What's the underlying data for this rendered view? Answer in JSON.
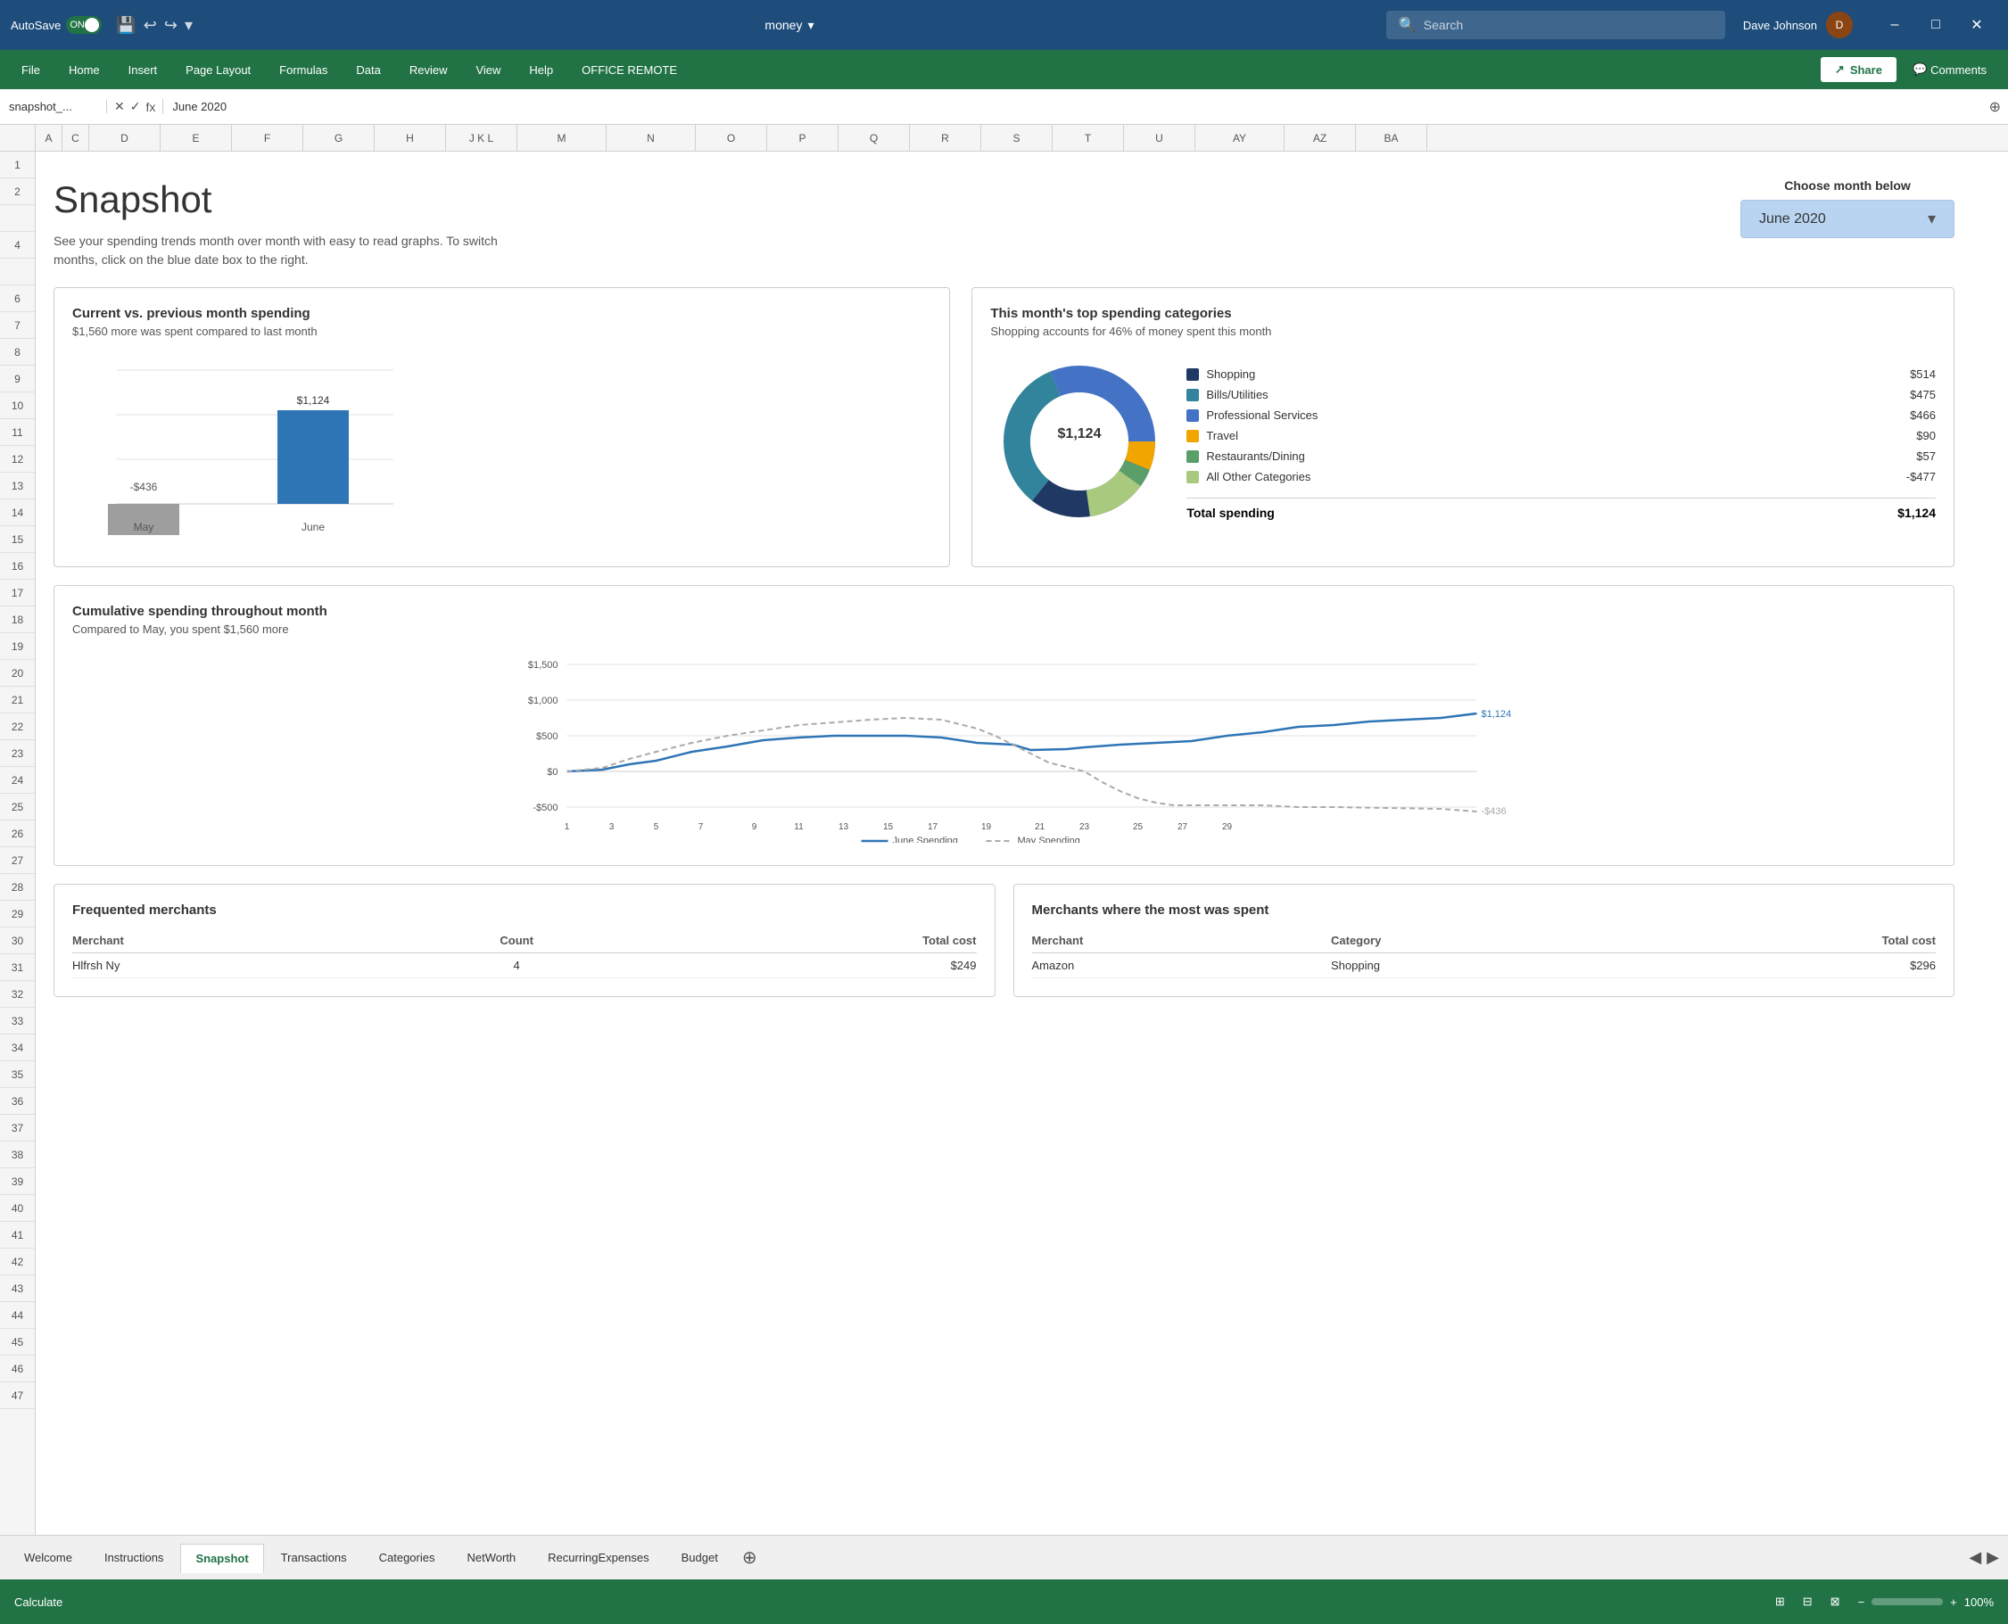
{
  "titlebar": {
    "autosave_label": "AutoSave",
    "autosave_state": "ON",
    "doc_name": "money",
    "search_placeholder": "Search",
    "user_name": "Dave Johnson"
  },
  "menubar": {
    "items": [
      "File",
      "Home",
      "Insert",
      "Page Layout",
      "Formulas",
      "Data",
      "Review",
      "View",
      "Help",
      "OFFICE REMOTE"
    ],
    "share_label": "Share",
    "comments_label": "Comments"
  },
  "formula_bar": {
    "name_box": "snapshot_...",
    "formula_value": "June 2020"
  },
  "snapshot": {
    "title": "Snapshot",
    "subtitle": "See your spending trends month over month with easy to read graphs. To switch months, click on the blue date box to the right.",
    "choose_month_label": "Choose month below",
    "selected_month": "June 2020",
    "bar_chart": {
      "title": "Current vs. previous month spending",
      "subtitle": "$1,560 more was spent compared to last month",
      "may_label": "May",
      "may_value": "-$436",
      "june_label": "June",
      "june_value": "$1,124"
    },
    "donut_chart": {
      "title": "This month's top spending categories",
      "subtitle": "Shopping accounts for 46% of money spent this month",
      "center_value": "$1,124",
      "categories": [
        {
          "name": "Shopping",
          "value": "$514",
          "color": "#1f3864"
        },
        {
          "name": "Bills/Utilities",
          "value": "$475",
          "color": "#31849b"
        },
        {
          "name": "Professional Services",
          "value": "$466",
          "color": "#4472c4"
        },
        {
          "name": "Travel",
          "value": "$90",
          "color": "#f0a500"
        },
        {
          "name": "Restaurants/Dining",
          "value": "$57",
          "color": "#70ad47"
        },
        {
          "name": "All Other Categories",
          "value": "-$477",
          "color": "#a9c97e"
        }
      ],
      "total_label": "Total spending",
      "total_value": "$1,124"
    },
    "cumulative_chart": {
      "title": "Cumulative spending throughout month",
      "subtitle": "Compared to May, you spent $1,560 more",
      "june_label": "June Spending",
      "may_label": "May Spending",
      "end_june": "$1,124",
      "end_may": "-$436"
    },
    "frequented_table": {
      "title": "Frequented merchants",
      "col1": "Merchant",
      "col2": "Count",
      "col3": "Total cost",
      "rows": [
        {
          "merchant": "Hlfrsh Ny",
          "count": "4",
          "cost": "$249"
        }
      ]
    },
    "most_spent_table": {
      "title": "Merchants where the most was spent",
      "col1": "Merchant",
      "col2": "Category",
      "col3": "Total cost",
      "rows": [
        {
          "merchant": "Amazon",
          "category": "Shopping",
          "cost": "$296"
        }
      ]
    }
  },
  "sheet_tabs": {
    "tabs": [
      "Welcome",
      "Instructions",
      "Snapshot",
      "Transactions",
      "Categories",
      "NetWorth",
      "RecurringExpenses",
      "Budget"
    ],
    "active": "Snapshot"
  },
  "status_bar": {
    "status": "Calculate",
    "zoom": "100%",
    "zoom_label": "100%"
  }
}
